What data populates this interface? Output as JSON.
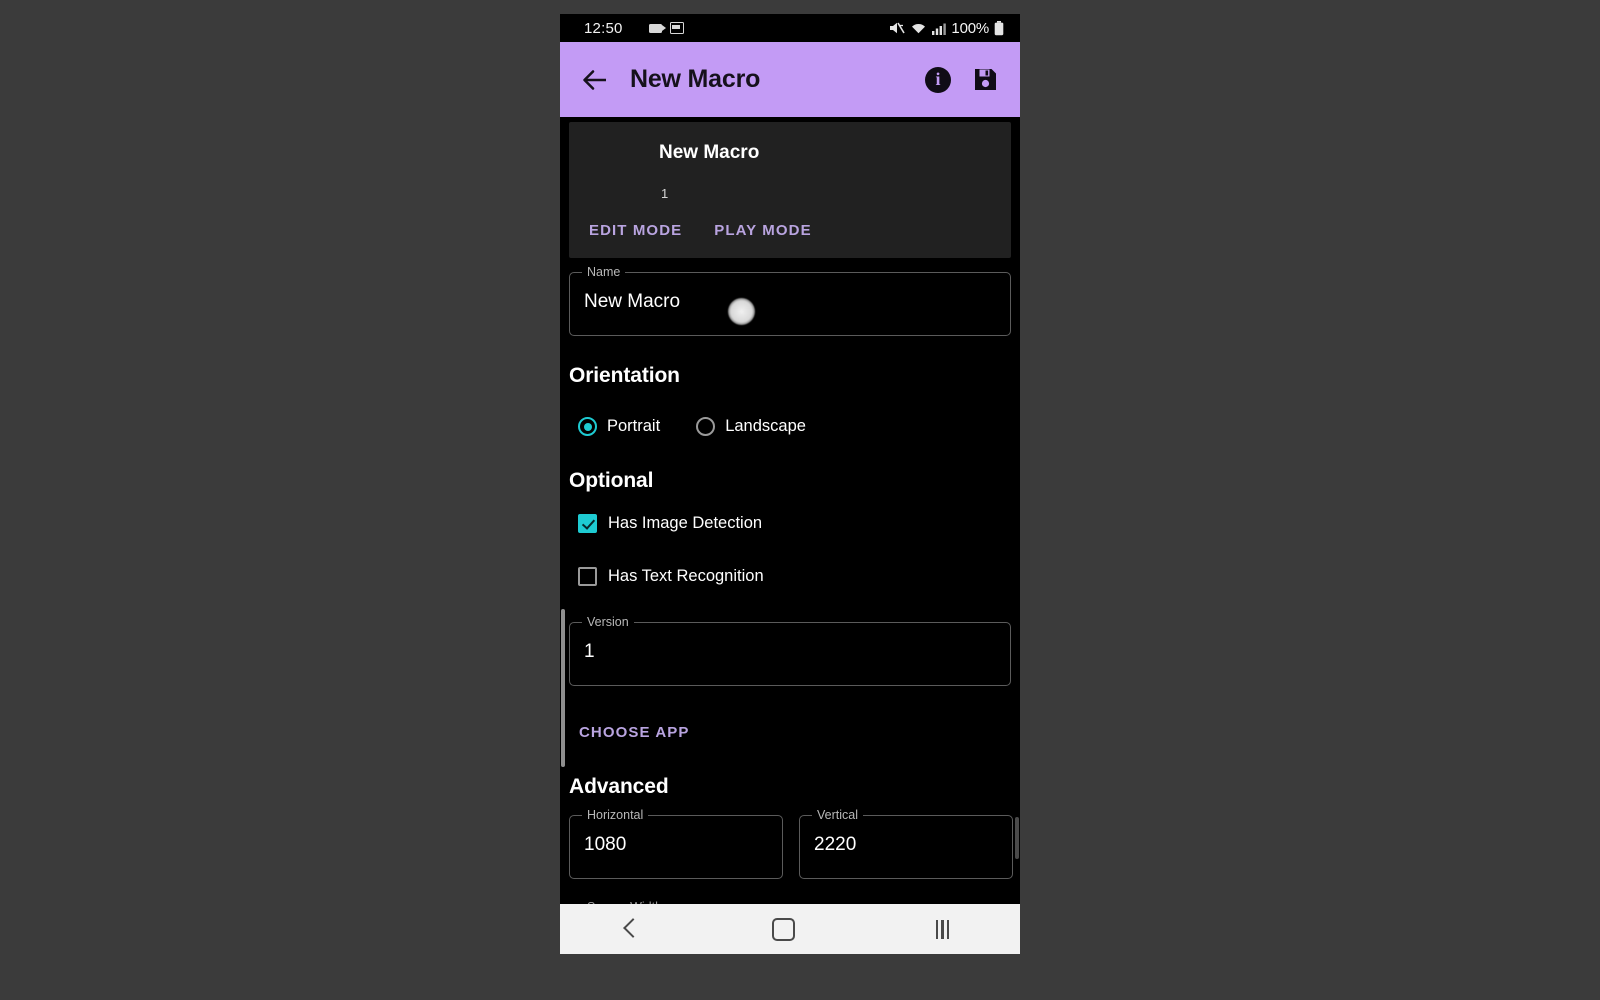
{
  "status_bar": {
    "time": "12:50",
    "battery_percent": "100%",
    "icons": [
      "cast-icon",
      "screenshot-icon",
      "mute-icon",
      "wifi-icon",
      "cellular-signal-icon",
      "battery-icon"
    ]
  },
  "app_bar": {
    "title": "New Macro",
    "back_icon": "back-arrow-icon",
    "info_icon_label": "i",
    "save_icon": "save-icon",
    "background_color": "#c39bf5"
  },
  "macro_card": {
    "title": "New Macro",
    "subtitle": "1",
    "edit_mode_label": "EDIT MODE",
    "play_mode_label": "PLAY MODE"
  },
  "fields": {
    "name": {
      "legend": "Name",
      "value": "New Macro"
    },
    "version": {
      "legend": "Version",
      "value": "1"
    },
    "horizontal": {
      "legend": "Horizontal",
      "value": "1080"
    },
    "vertical": {
      "legend": "Vertical",
      "value": "2220"
    },
    "cut_off": {
      "legend": "Screen Width"
    }
  },
  "orientation": {
    "heading": "Orientation",
    "options": [
      {
        "label": "Portrait",
        "selected": true
      },
      {
        "label": "Landscape",
        "selected": false
      }
    ]
  },
  "optional": {
    "heading": "Optional",
    "checkboxes": [
      {
        "label": "Has Image Detection",
        "checked": true
      },
      {
        "label": "Has Text Recognition",
        "checked": false
      }
    ]
  },
  "choose_app_label": "CHOOSE APP",
  "advanced": {
    "heading": "Advanced"
  },
  "nav_bar": {
    "back_icon": "nav-back-icon",
    "home_icon": "nav-home-icon",
    "recents_icon": "nav-recents-icon"
  },
  "colors": {
    "accent_purple": "#c39bf5",
    "accent_teal": "#1ecbd2",
    "text_button": "#b9a4e0",
    "card_background": "#212121",
    "page_background": "#000000"
  }
}
